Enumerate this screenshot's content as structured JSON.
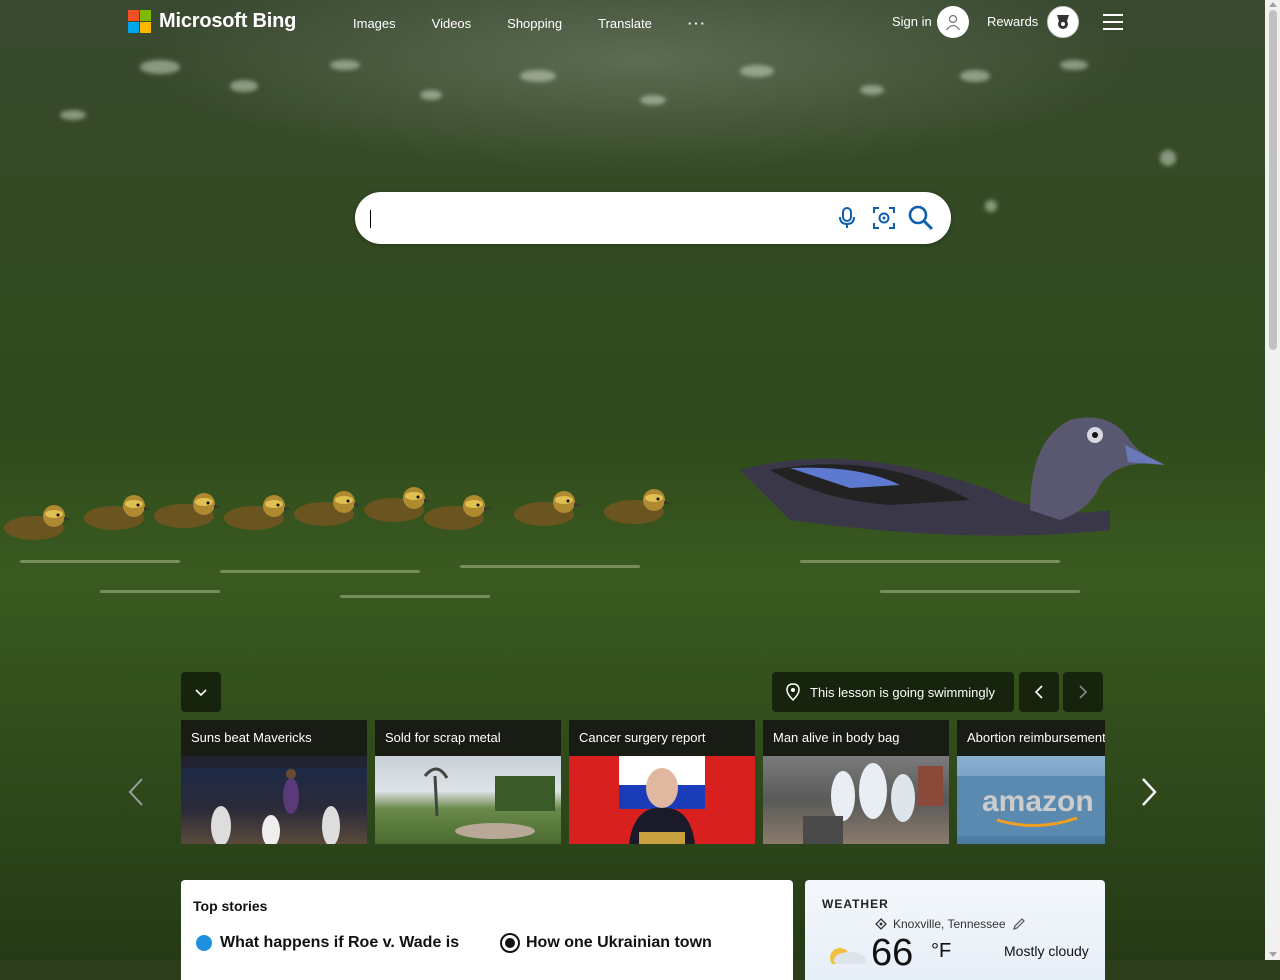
{
  "header": {
    "logo_text": "Microsoft Bing",
    "nav": [
      "Images",
      "Videos",
      "Shopping",
      "Translate"
    ],
    "more_label": "···",
    "signin_label": "Sign in",
    "rewards_label": "Rewards"
  },
  "search": {
    "placeholder": "",
    "value": ""
  },
  "image_info": {
    "caption": "This lesson is going swimmingly"
  },
  "carousel": {
    "cards": [
      {
        "title": "Suns beat Mavericks"
      },
      {
        "title": "Sold for scrap metal"
      },
      {
        "title": "Cancer surgery report"
      },
      {
        "title": "Man alive in body bag"
      },
      {
        "title": "Abortion reimbursement"
      }
    ]
  },
  "top_stories": {
    "header": "Top stories",
    "items": [
      {
        "title": "What happens if Roe v. Wade is"
      },
      {
        "title": "How one Ukrainian town"
      }
    ]
  },
  "weather": {
    "title": "WEATHER",
    "location": "Knoxville, Tennessee",
    "temperature": "66",
    "unit": "°F",
    "condition": "Mostly cloudy"
  },
  "colors": {
    "ms_red": "#f25022",
    "ms_green": "#7fba00",
    "ms_blue": "#00a4ef",
    "ms_yellow": "#ffb900",
    "search_icon": "#0f5fad"
  },
  "icons": [
    "microphone-icon",
    "visual-search-icon",
    "search-icon",
    "location-pin-icon",
    "chevron-down-icon",
    "chevron-left-icon",
    "chevron-right-icon",
    "hamburger-menu-icon",
    "rewards-medal-icon",
    "user-avatar-icon",
    "edit-pencil-icon",
    "partly-cloudy-icon"
  ]
}
